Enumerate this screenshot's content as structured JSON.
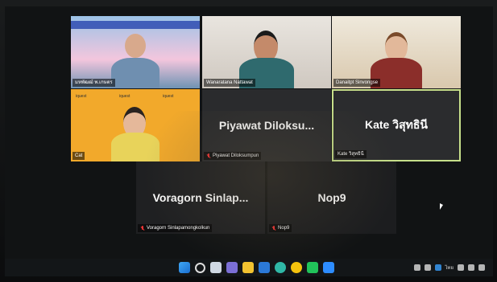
{
  "participants": [
    {
      "name": "มหพัฒฒ์ พ.เกษตร",
      "video": true,
      "muted": false
    },
    {
      "name": "Wanaratana Nattawat",
      "video": true,
      "muted": false
    },
    {
      "name": "Danaitpt Sinvongse",
      "video": true,
      "muted": false
    },
    {
      "name": "Cat",
      "video": true,
      "muted": false
    },
    {
      "name": "Piyawat Diloksumpun",
      "display": "Piyawat  Diloksu...",
      "video": false,
      "muted": true
    },
    {
      "name": "Kate วิสุทธินี",
      "display": "Kate วิสุทธินี",
      "video": false,
      "muted": false,
      "active_speaker": true
    },
    {
      "name": "Voragorn Sinlapamongkolkun",
      "display": "Voragorn  Sinlap...",
      "video": false,
      "muted": true
    },
    {
      "name": "Nop9",
      "display": "Nop9",
      "video": false,
      "muted": true
    }
  ],
  "tile_texts": {
    "t4_logo": "iquest"
  },
  "taskbar": {
    "apps": [
      "start",
      "search",
      "task-view",
      "chat",
      "file-explorer",
      "store",
      "edge",
      "chrome",
      "line",
      "zoom"
    ],
    "tray_text": "ไทย"
  },
  "colors": {
    "active_speaker_border": "#c7e08a",
    "muted_icon": "#e33333"
  }
}
